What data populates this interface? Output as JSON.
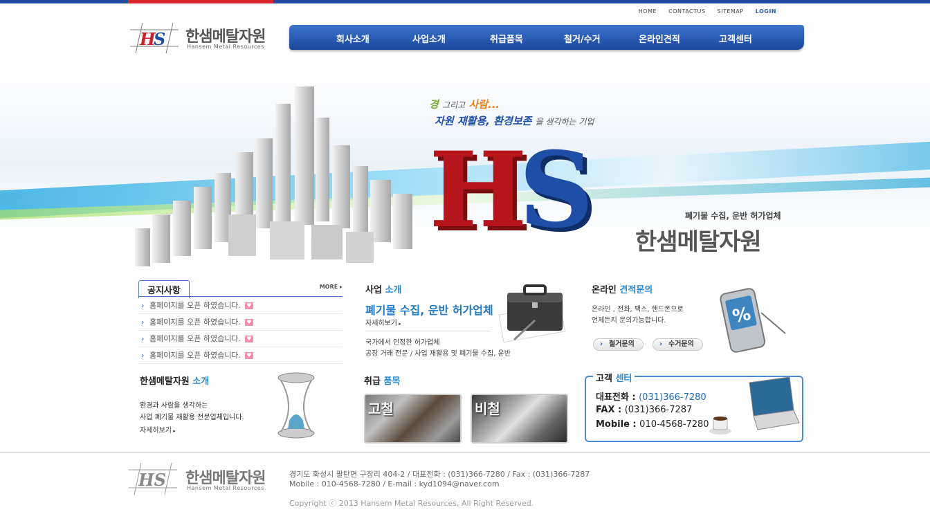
{
  "header": {
    "top_links": [
      "HOME",
      "CONTACTUS",
      "SITEMAP",
      "LOGIN"
    ],
    "logo_mark": "HS",
    "logo_name": "한샘메탈자원",
    "logo_sub": "Hansem Metal Resources"
  },
  "nav": {
    "items": [
      "회사소개",
      "사업소개",
      "취급품목",
      "철거/수거",
      "온라인견적",
      "고객센터"
    ]
  },
  "hero": {
    "slogan_word1": "경",
    "slogan_mid": "그리고",
    "slogan_word2": "사람...",
    "slogan_line2": "자원 재활용, 환경보존",
    "slogan_line2_tail": "을 생각하는 기업",
    "hs_h": "H",
    "hs_s": "S",
    "tagline": "폐기물 수집, 운반 허가업체",
    "company": "한샘메탈자원"
  },
  "notice": {
    "title": "공지사항",
    "more": "MORE",
    "items": [
      "홈페이지를 오픈 하였습니다.",
      "홈페이지를 오픈 하였습니다.",
      "홈페이지를 오픈 하였습니다.",
      "홈페이지를 오픈 하였습니다."
    ]
  },
  "business": {
    "title_a": "사업",
    "title_b": "소개",
    "headline": "폐기물 수집, 운반 허가업체",
    "more": "자세히보기",
    "desc1": "국가에서 인정한 허가업체",
    "desc2": "공장 거래 전문 / 사업 재활용 및 폐기물 수집, 운반"
  },
  "online": {
    "title_a": "온라인",
    "title_b": "견적문의",
    "desc1": "온라인 , 전화, 팩스, 핸드폰으로",
    "desc2": "언제든지 문의가능합니다.",
    "btn1": "철거문의",
    "btn2": "수거문의",
    "phone_symbol": "%"
  },
  "intro": {
    "title_a": "한샘메탈자원",
    "title_b": "소개",
    "desc1": "환경과 사람을 생각하는",
    "desc2": "사업 폐기물 재활용 전문업체입니다.",
    "more": "자세히보기"
  },
  "items": {
    "title_a": "취급",
    "title_b": "품목",
    "thumbs": [
      "고철",
      "비철"
    ]
  },
  "customer": {
    "title_a": "고객",
    "title_b": "센터",
    "rows": [
      {
        "label": "대표전화 :",
        "value": "(031)366-7280"
      },
      {
        "label": "FAX :",
        "value": "(031)366-7287"
      },
      {
        "label": "Mobile :",
        "value": "010-4568-7280"
      }
    ]
  },
  "footer": {
    "address": "경기도 화성시 팔탄면 구장리 404-2 / 대표전화 : (031)366-7280 / Fax : (031)366-7287",
    "contact": "Mobile : 010-4568-7280 / E-mail : kyd1094@naver.com",
    "copyright": "Copyright ⓒ 2013 Hansem Metal Resources, All Right Reserved."
  },
  "colors": {
    "brand_blue": "#1f4aa0",
    "brand_red": "#b5151b",
    "accent_blue": "#2a8ad6"
  }
}
